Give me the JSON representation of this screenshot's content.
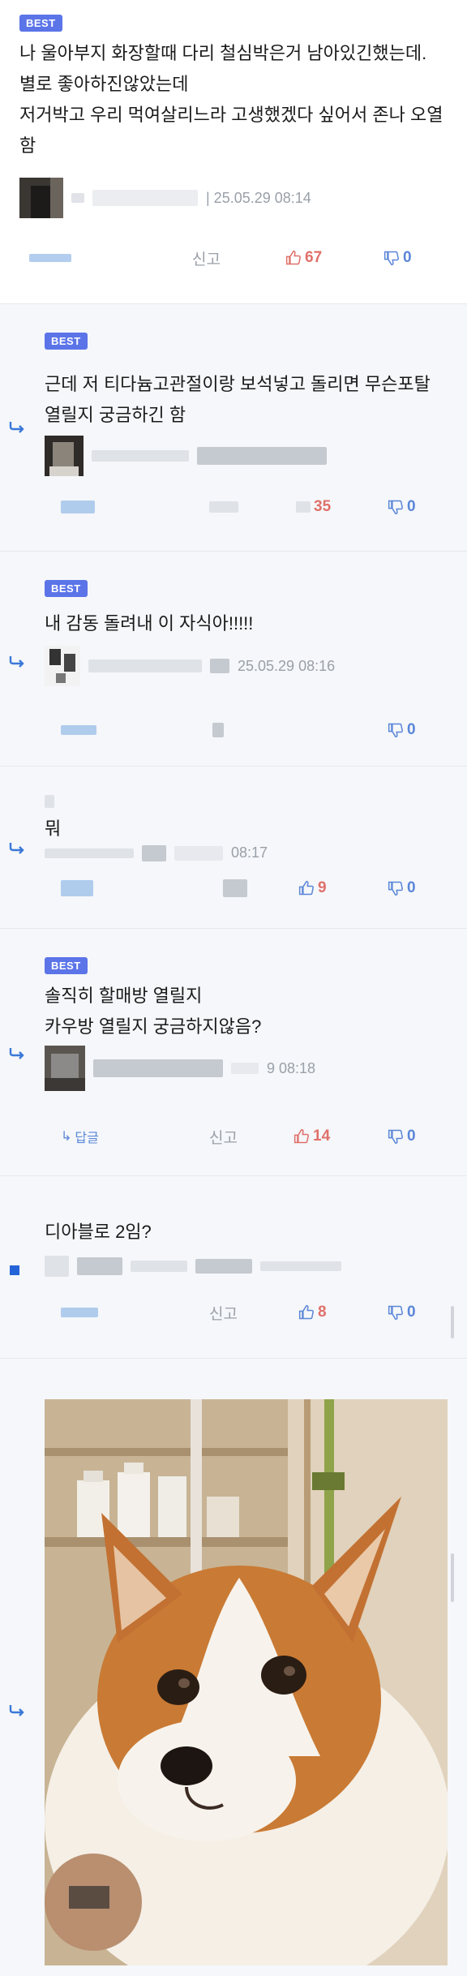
{
  "labels": {
    "best": "BEST",
    "report": "신고",
    "reply": "답글"
  },
  "comments": [
    {
      "content": "나 울아부지 화장할때 다리 철심박은거 남아있긴했는데.\n별로 좋아하진않았는데\n저거박고 우리 먹여살리느라 고생했겠다 싶어서 존나 오열함",
      "timestamp": "| 25.05.29 08:14",
      "likes": "67",
      "dislikes": "0"
    },
    {
      "content": "근데 저 티다늄고관절이랑 보석넣고 돌리면 무슨포탈 열릴지 궁금하긴 함",
      "likes": "35",
      "dislikes": "0"
    },
    {
      "content": "내 감동 돌려내 이 자식아!!!!!",
      "timestamp": "25.05.29 08:16",
      "dislikes": "0"
    },
    {
      "content": "뭐",
      "timestamp": "08:17",
      "likes": "9",
      "dislikes": "0"
    },
    {
      "content": "솔직히 할매방 열릴지\n카우방 열릴지 궁금하지않음?",
      "timestamp": "9 08:18",
      "likes": "14",
      "dislikes": "0"
    },
    {
      "content": "디아블로 2임?",
      "likes": "8",
      "dislikes": "0"
    }
  ],
  "colors": {
    "accent": "#5b74e8",
    "like": "#e0706a",
    "dislike": "#5b86d8",
    "reply_bg": "#f5f7fa"
  },
  "photo": {
    "icon": "corgi-photo"
  }
}
